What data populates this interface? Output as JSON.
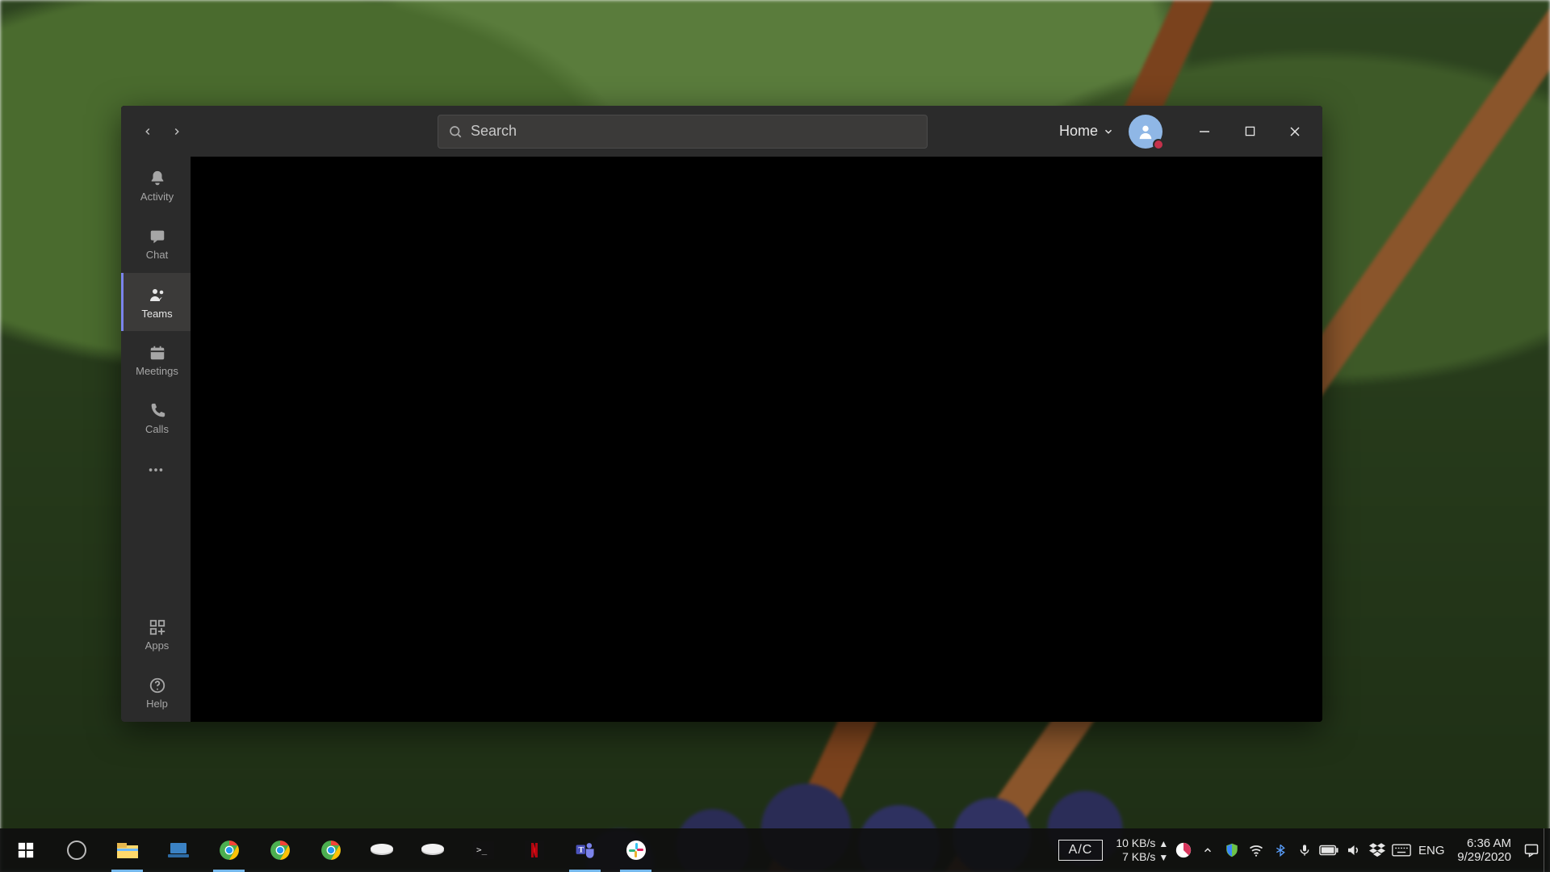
{
  "app": {
    "search_placeholder": "Search",
    "org_label": "Home",
    "rail": {
      "activity": "Activity",
      "chat": "Chat",
      "teams": "Teams",
      "meetings": "Meetings",
      "calls": "Calls",
      "apps": "Apps",
      "help": "Help"
    },
    "avatar_presence": "busy"
  },
  "taskbar": {
    "ac_label": "A/C",
    "net_up": "10 KB/s",
    "net_down": "7 KB/s",
    "lang": "ENG",
    "time": "6:36 AM",
    "date": "9/29/2020",
    "pinned": [
      {
        "name": "start",
        "open": false
      },
      {
        "name": "cortana",
        "open": false
      },
      {
        "name": "file-explorer",
        "open": true
      },
      {
        "name": "laptop-app",
        "open": false
      },
      {
        "name": "chrome-profile-1",
        "open": true
      },
      {
        "name": "chrome-profile-2",
        "open": false
      },
      {
        "name": "chrome-profile-3",
        "open": false
      },
      {
        "name": "drive-1",
        "open": false
      },
      {
        "name": "drive-2",
        "open": false
      },
      {
        "name": "terminal",
        "open": false
      },
      {
        "name": "netflix",
        "open": false
      },
      {
        "name": "teams",
        "open": true
      },
      {
        "name": "slack",
        "open": true
      }
    ],
    "tray": [
      "pie-cpu",
      "chevron-up",
      "security",
      "wifi",
      "bluetooth",
      "mic",
      "battery",
      "volume",
      "dropbox",
      "keyboard"
    ]
  }
}
